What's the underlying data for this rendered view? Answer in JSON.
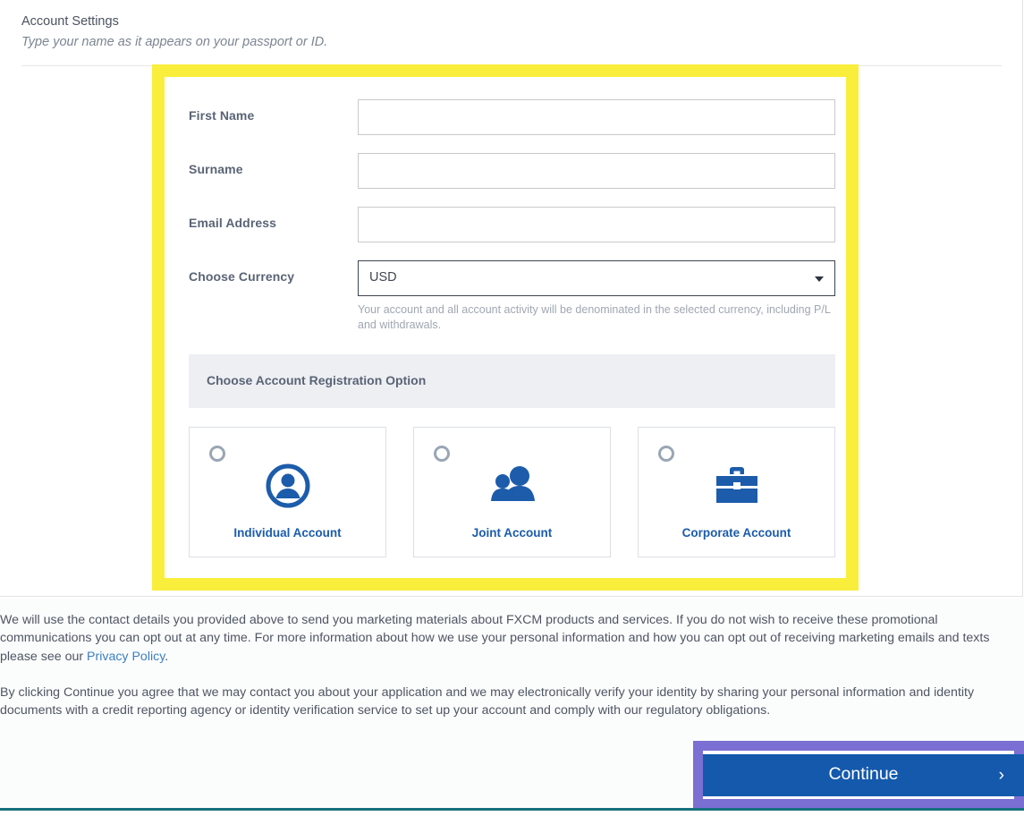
{
  "header": {
    "title": "Account Settings",
    "subtitle": "Type your name as it appears on your passport or ID."
  },
  "form": {
    "fields": [
      {
        "label": "First Name",
        "value": "",
        "placeholder": "",
        "type": "text",
        "name": "first-name"
      },
      {
        "label": "Surname",
        "value": "",
        "placeholder": "",
        "type": "text",
        "name": "surname"
      },
      {
        "label": "Email Address",
        "value": "",
        "placeholder": "",
        "type": "text",
        "name": "email-address"
      }
    ],
    "currency": {
      "label": "Choose Currency",
      "selected": "USD",
      "help": "Your account and all account activity will be denominated in the selected currency, including P/L and withdrawals."
    }
  },
  "registration": {
    "section_title": "Choose Account Registration Option",
    "options": [
      {
        "label": "Individual Account",
        "icon": "person-circle-icon",
        "selected": false
      },
      {
        "label": "Joint Account",
        "icon": "two-people-icon",
        "selected": false
      },
      {
        "label": "Corporate Account",
        "icon": "briefcase-icon",
        "selected": false
      }
    ]
  },
  "disclaimers": {
    "marketing_part1": "We will use the contact details you provided above to send you marketing materials about FXCM products and services. If you do not wish to receive these promotional communications you can opt out at any time. For more information about how we use your personal information and how you can opt out of receiving marketing emails and texts please see our ",
    "privacy_link": "Privacy Policy",
    "marketing_part2": ".",
    "identity": "By clicking Continue you agree that we may contact you about your application and we may electronically verify your identity by sharing your personal information and identity documents with a credit reporting agency or identity verification service to set up your account and comply with our regulatory obligations."
  },
  "footer": {
    "continue_label": "Continue",
    "continue_chevron": "›"
  },
  "colors": {
    "highlight_yellow": "#faee3c",
    "highlight_purple": "#7b6fd4",
    "brand_blue": "#1459ac",
    "icon_blue": "#1c5cab",
    "link_blue": "#3b7fc4",
    "bottom_rule_teal": "#17707f"
  }
}
